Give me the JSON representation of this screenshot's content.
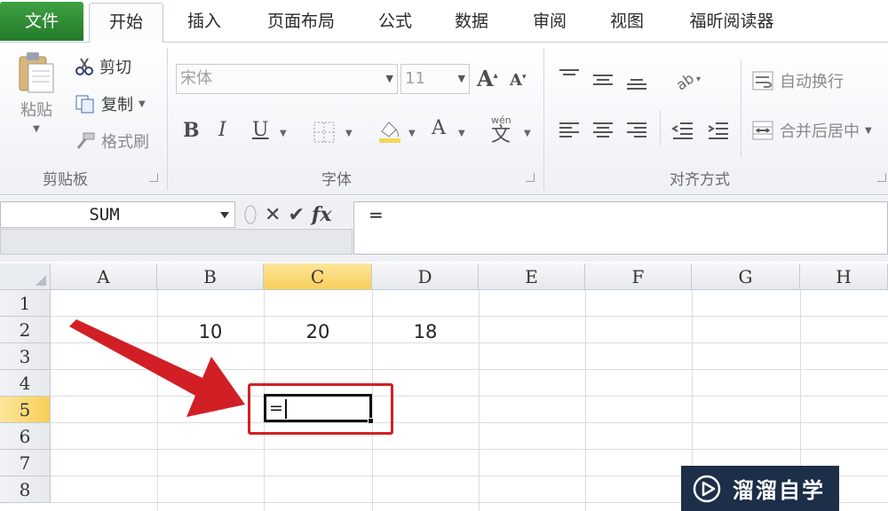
{
  "tabs": {
    "file": "文件",
    "home": "开始",
    "insert": "插入",
    "page_layout": "页面布局",
    "formulas": "公式",
    "data": "数据",
    "review": "审阅",
    "view": "视图",
    "foxit": "福昕阅读器"
  },
  "clipboard": {
    "paste": "粘贴",
    "cut": "剪切",
    "copy": "复制",
    "format_painter": "格式刷",
    "group_label": "剪贴板"
  },
  "font": {
    "name": "宋体",
    "size": "11",
    "bold": "B",
    "italic": "I",
    "underline": "U",
    "font_color": "A",
    "phonetic": "wén",
    "group_label": "字体"
  },
  "alignment": {
    "wrap_text": "自动换行",
    "merge_center": "合并后居中",
    "group_label": "对齐方式"
  },
  "formula_bar": {
    "name_box": "SUM",
    "fx": "fx",
    "content": "="
  },
  "sheet": {
    "columns": [
      "A",
      "B",
      "C",
      "D",
      "E",
      "F",
      "G",
      "H"
    ],
    "rows": [
      "1",
      "2",
      "3",
      "4",
      "5",
      "6",
      "7",
      "8"
    ],
    "row2": {
      "B": "10",
      "C": "20",
      "D": "18"
    },
    "active_cell_content": "="
  },
  "watermark": {
    "text": "溜溜自学"
  },
  "colors": {
    "file_tab": "#2f8f35",
    "selected_header": "#f7cf58",
    "annotation_red": "#d21f26",
    "watermark_bg": "#1d2e49"
  }
}
